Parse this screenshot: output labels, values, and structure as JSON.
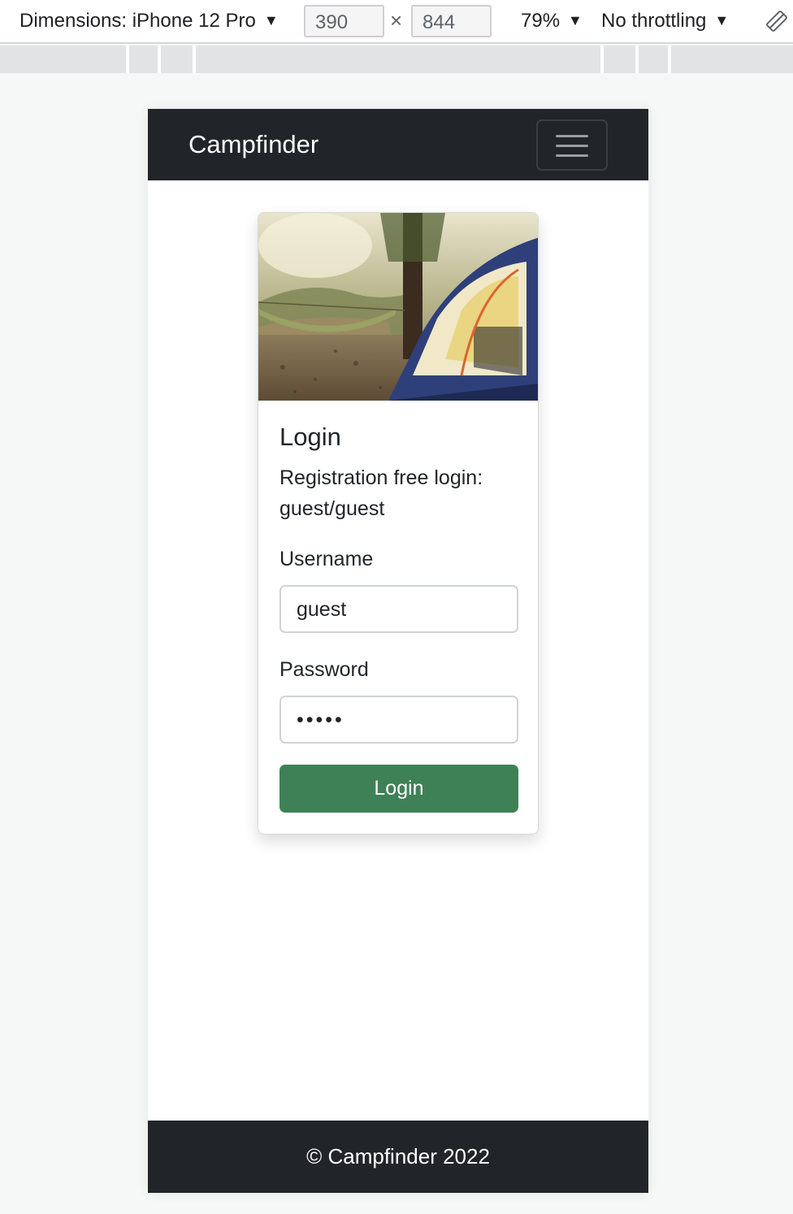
{
  "devtools": {
    "dimensions_label": "Dimensions: iPhone 12 Pro",
    "width": "390",
    "height": "844",
    "times": "×",
    "zoom": "79%",
    "throttling": "No throttling",
    "dropdown_arrow": "▼"
  },
  "navbar": {
    "brand": "Campfinder"
  },
  "login_card": {
    "image_alt": "camping tent and hammock in forest",
    "title": "Login",
    "info_text": "Registration free login: guest/guest",
    "username_label": "Username",
    "username_value": "guest",
    "password_label": "Password",
    "password_value": "•••••",
    "submit_label": "Login"
  },
  "footer": {
    "text": "© Campfinder 2022"
  },
  "colors": {
    "navbar_bg": "#212529",
    "button_green": "#3e8157"
  }
}
